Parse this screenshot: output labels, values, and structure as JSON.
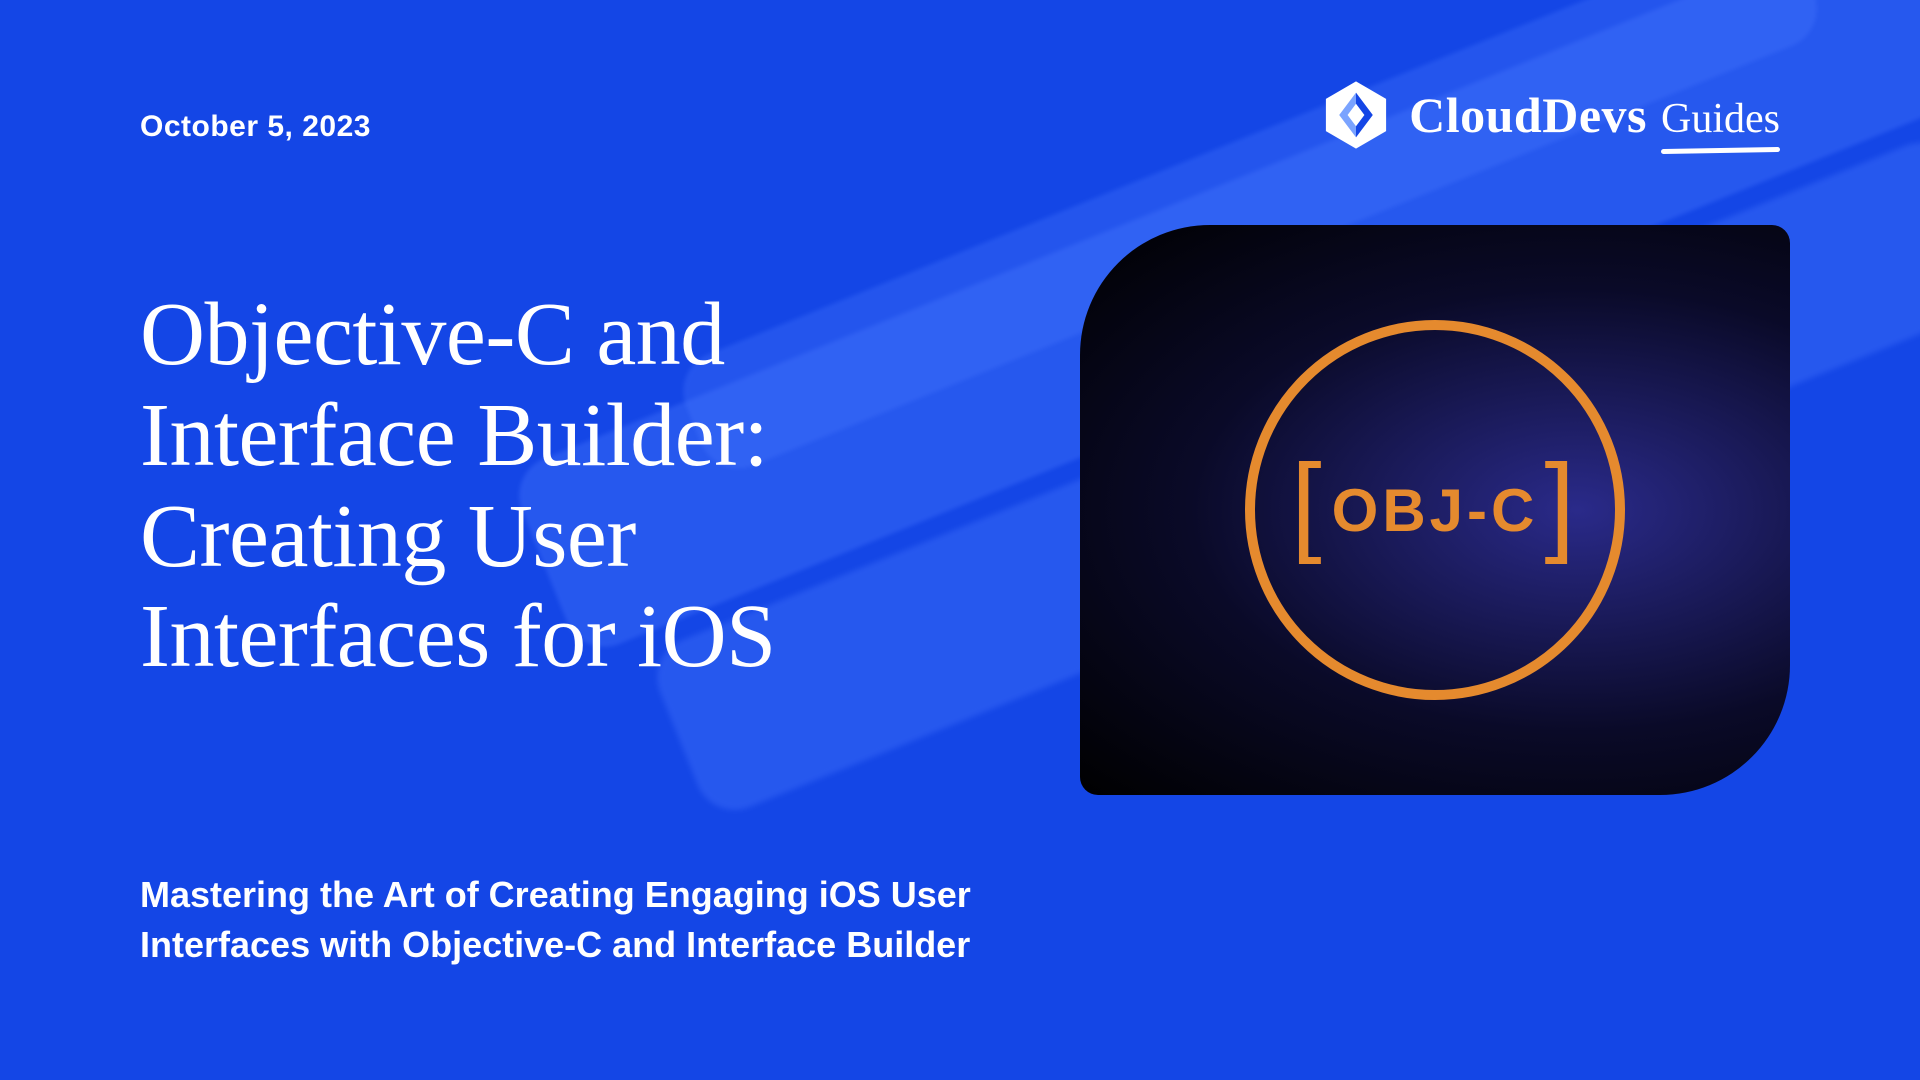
{
  "date": "October 5, 2023",
  "logo": {
    "name": "CloudDevs",
    "sub": "Guides"
  },
  "title": "Objective-C and Interface Builder: Creating User Interfaces for iOS",
  "subtitle": "Mastering the Art of Creating Engaging iOS User Interfaces with Objective-C and Interface Builder",
  "badge": {
    "label": "OBJ-C"
  },
  "colors": {
    "background": "#1446e6",
    "accent_orange": "#e58a2e",
    "card_dark": "#0a0a28"
  }
}
